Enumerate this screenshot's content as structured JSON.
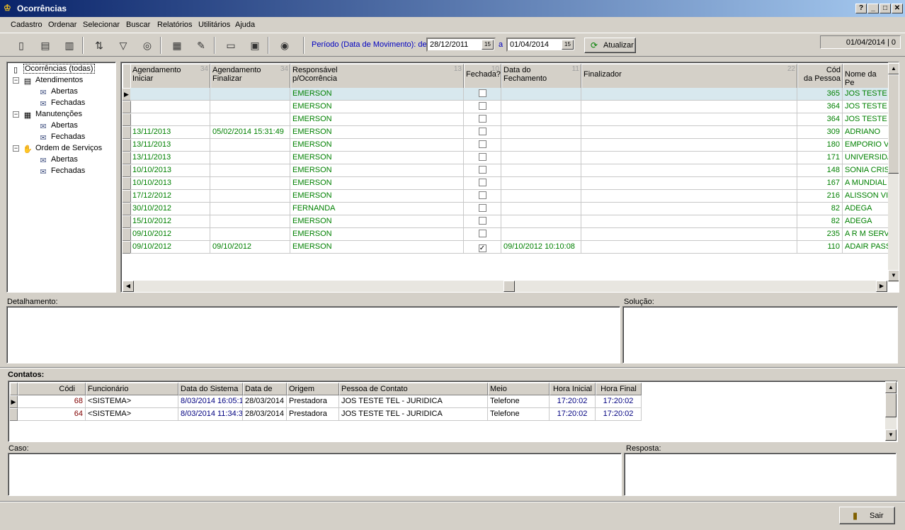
{
  "window": {
    "title": "Ocorrências",
    "buttons": [
      "?",
      "_",
      "□",
      "✕"
    ]
  },
  "menu": [
    "Cadastro",
    "Ordenar",
    "Selecionar",
    "Buscar",
    "Relatórios",
    "Utilitários",
    "Ajuda"
  ],
  "status_date": "01/04/2014 | 0",
  "toolbar": {
    "period_label": "Período (Data de Movimento): de",
    "date_from": "28/12/2011",
    "to_label": "a",
    "date_to": "01/04/2014",
    "refresh_label": "Atualizar",
    "date_btn": "15"
  },
  "tree": {
    "root": "Ocorrências (todas)",
    "groups": [
      {
        "label": "Atendimentos",
        "children": [
          "Abertas",
          "Fechadas"
        ]
      },
      {
        "label": "Manutenções",
        "children": [
          "Abertas",
          "Fechadas"
        ]
      },
      {
        "label": "Ordem de Serviços",
        "children": [
          "Abertas",
          "Fechadas"
        ]
      }
    ]
  },
  "grid": {
    "headers": [
      {
        "l1": "Agendamento",
        "l2": "Iniciar",
        "n": "34"
      },
      {
        "l1": "Agendamento",
        "l2": "Finalizar",
        "n": "34"
      },
      {
        "l1": "Responsável",
        "l2": "p/Ocorrência",
        "n": "13"
      },
      {
        "l1": "Fechada?",
        "l2": "",
        "n": "10"
      },
      {
        "l1": "Data do",
        "l2": "Fechamento",
        "n": "11"
      },
      {
        "l1": "Finalizador",
        "l2": "",
        "n": "22"
      },
      {
        "l1": "Cód",
        "l2": "da Pessoa",
        "n": ""
      },
      {
        "l1": "Nome da Pe",
        "l2": "",
        "n": ""
      }
    ],
    "rows": [
      [
        "",
        "",
        "EMERSON",
        false,
        "",
        "",
        "365",
        "JOS TESTE"
      ],
      [
        "",
        "",
        "EMERSON",
        false,
        "",
        "",
        "364",
        "JOS TESTE"
      ],
      [
        "",
        "",
        "EMERSON",
        false,
        "",
        "",
        "364",
        "JOS TESTE"
      ],
      [
        "13/11/2013",
        "05/02/2014 15:31:49",
        "EMERSON",
        false,
        "",
        "",
        "309",
        "ADRIANO"
      ],
      [
        "13/11/2013",
        "",
        "EMERSON",
        false,
        "",
        "",
        "180",
        "EMPORIO VI"
      ],
      [
        "13/11/2013",
        "",
        "EMERSON",
        false,
        "",
        "",
        "171",
        "UNIVERSIDA"
      ],
      [
        "10/10/2013",
        "",
        "EMERSON",
        false,
        "",
        "",
        "148",
        "SONIA CRIS"
      ],
      [
        "10/10/2013",
        "",
        "EMERSON",
        false,
        "",
        "",
        "167",
        "A MUNDIAL"
      ],
      [
        "17/12/2012",
        "",
        "EMERSON",
        false,
        "",
        "",
        "216",
        "ALISSON VII"
      ],
      [
        "30/10/2012",
        "",
        "FERNANDA",
        false,
        "",
        "",
        "82",
        "ADEGA"
      ],
      [
        "15/10/2012",
        "",
        "EMERSON",
        false,
        "",
        "",
        "82",
        "ADEGA"
      ],
      [
        "09/10/2012",
        "",
        "EMERSON",
        false,
        "",
        "",
        "235",
        "A R M SERV"
      ],
      [
        "09/10/2012",
        "09/10/2012",
        "EMERSON",
        true,
        "09/10/2012 10:10:08",
        "",
        "110",
        "ADAIR PASS"
      ]
    ]
  },
  "sections": {
    "detail": "Detalhamento:",
    "solution": "Solução:",
    "contacts": "Contatos:",
    "case": "Caso:",
    "answer": "Resposta:"
  },
  "contacts": {
    "headers": [
      "Códi",
      "Funcionário",
      "Data do Sistema",
      "Data de",
      "Origem",
      "Pessoa de Contato",
      "Meio",
      "Hora Inicial",
      "Hora Final"
    ],
    "rows": [
      [
        "68",
        "<SISTEMA>",
        "8/03/2014 16:05:1",
        "28/03/2014",
        "Prestadora",
        "JOS TESTE TEL - JURIDICA",
        "Telefone",
        "17:20:02",
        "17:20:02"
      ],
      [
        "64",
        "<SISTEMA>",
        "8/03/2014 11:34:3",
        "28/03/2014",
        "Prestadora",
        "JOS TESTE TEL - JURIDICA",
        "Telefone",
        "17:20:02",
        "17:20:02"
      ]
    ]
  },
  "exit_label": "Sair"
}
